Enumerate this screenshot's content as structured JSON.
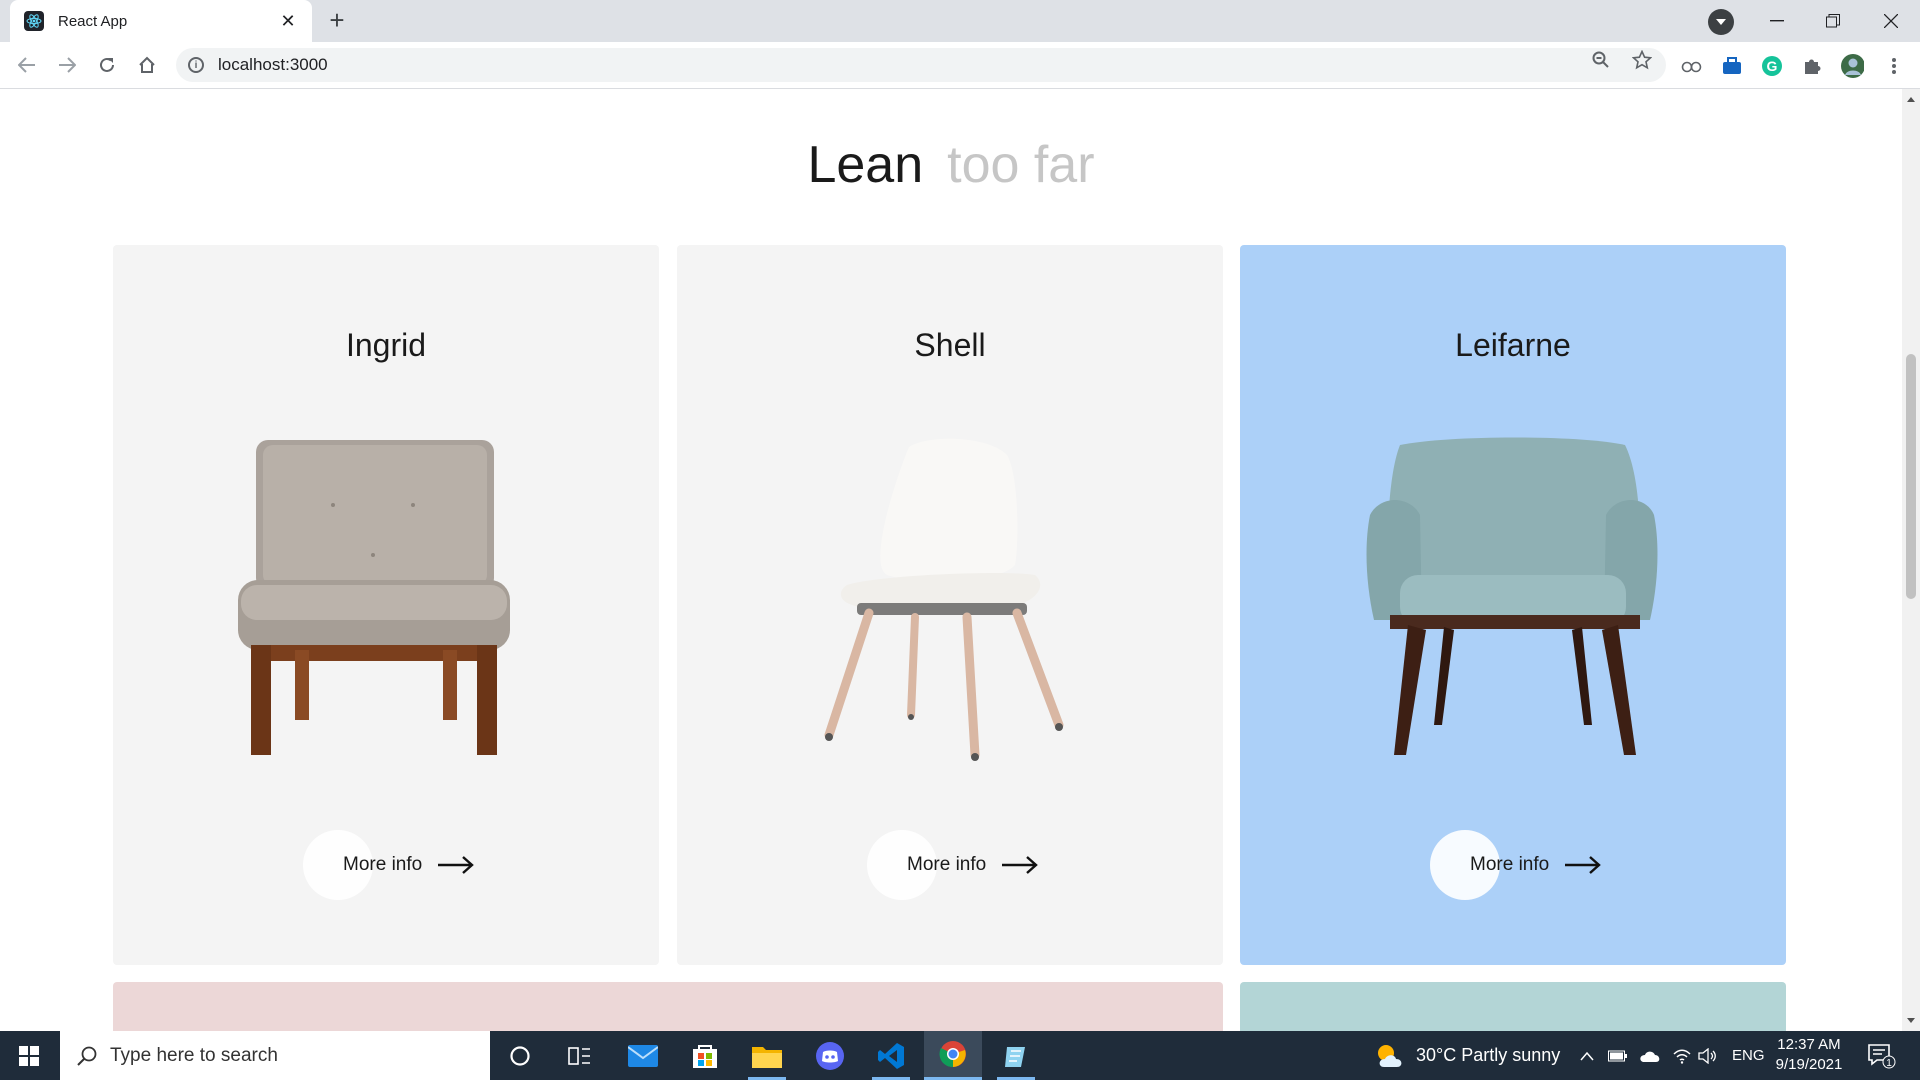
{
  "browser": {
    "tab_title": "React App",
    "url": "localhost:3000"
  },
  "page": {
    "heading_primary": "Lean",
    "heading_secondary": "too far",
    "cards": [
      {
        "name": "Ingrid",
        "button_label": "More info",
        "background": "#f4f4f4"
      },
      {
        "name": "Shell",
        "button_label": "More info",
        "background": "#f4f4f4"
      },
      {
        "name": "Leifarne",
        "button_label": "More info",
        "background": "#acd0f8"
      }
    ],
    "next_row_colors": [
      "#ecd7d7",
      "#b3d5d6"
    ]
  },
  "taskbar": {
    "search_placeholder": "Type here to search",
    "weather": "30°C  Partly sunny",
    "language": "ENG",
    "time": "12:37 AM",
    "date": "9/19/2021",
    "notification_count": "1"
  }
}
